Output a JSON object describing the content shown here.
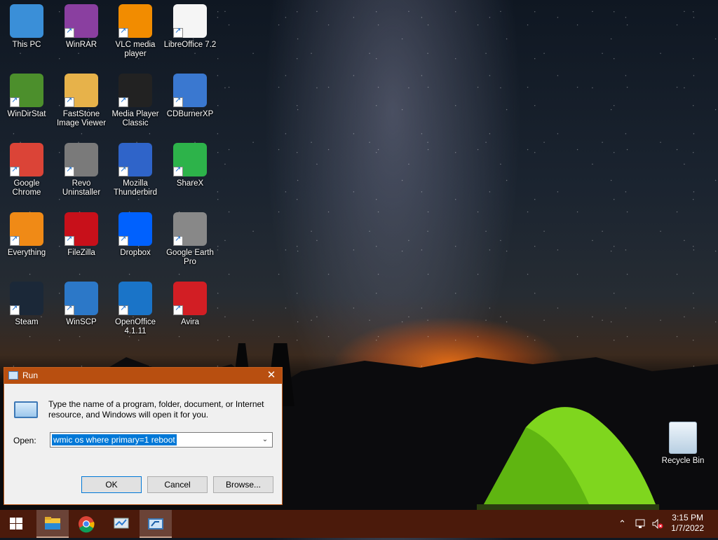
{
  "desktop": {
    "icons": [
      {
        "label": "This PC",
        "icon": "computer-icon"
      },
      {
        "label": "WinRAR",
        "icon": "winrar-icon"
      },
      {
        "label": "VLC media player",
        "icon": "vlc-icon"
      },
      {
        "label": "LibreOffice 7.2",
        "icon": "libreoffice-icon"
      },
      {
        "label": "WinDirStat",
        "icon": "windirstat-icon"
      },
      {
        "label": "FastStone Image Viewer",
        "icon": "faststone-icon"
      },
      {
        "label": "Media Player Classic",
        "icon": "media-player-classic-icon"
      },
      {
        "label": "CDBurnerXP",
        "icon": "cdburnerxp-icon"
      },
      {
        "label": "Google Chrome",
        "icon": "chrome-icon"
      },
      {
        "label": "Revo Uninstaller",
        "icon": "revo-uninstaller-icon"
      },
      {
        "label": "Mozilla Thunderbird",
        "icon": "thunderbird-icon"
      },
      {
        "label": "ShareX",
        "icon": "sharex-icon"
      },
      {
        "label": "Everything",
        "icon": "everything-icon"
      },
      {
        "label": "FileZilla",
        "icon": "filezilla-icon"
      },
      {
        "label": "Dropbox",
        "icon": "dropbox-icon"
      },
      {
        "label": "Google Earth Pro",
        "icon": "google-earth-icon"
      },
      {
        "label": "Steam",
        "icon": "steam-icon"
      },
      {
        "label": "WinSCP",
        "icon": "winscp-icon"
      },
      {
        "label": "OpenOffice 4.1.11",
        "icon": "openoffice-icon"
      },
      {
        "label": "Avira",
        "icon": "avira-icon"
      }
    ],
    "recycle_bin": {
      "label": "Recycle Bin",
      "icon": "recycle-bin-icon"
    }
  },
  "run_dialog": {
    "title": "Run",
    "description": "Type the name of a program, folder, document, or Internet resource, and Windows will open it for you.",
    "open_label": "Open:",
    "open_value": "wmic os where primary=1 reboot",
    "ok_label": "OK",
    "cancel_label": "Cancel",
    "browse_label": "Browse...",
    "close_glyph": "✕"
  },
  "taskbar": {
    "pinned": [
      "start-icon",
      "file-explorer-icon",
      "chrome-icon",
      "control-panel-icon",
      "run-icon"
    ],
    "clock_time": "3:15 PM",
    "clock_date": "1/7/2022",
    "tray_icons": [
      "chevron-up-icon",
      "network-icon",
      "volume-muted-icon"
    ]
  },
  "colors": {
    "taskbar": "#4b1a0b",
    "accent": "#b84f10",
    "selection": "#0078d7"
  }
}
